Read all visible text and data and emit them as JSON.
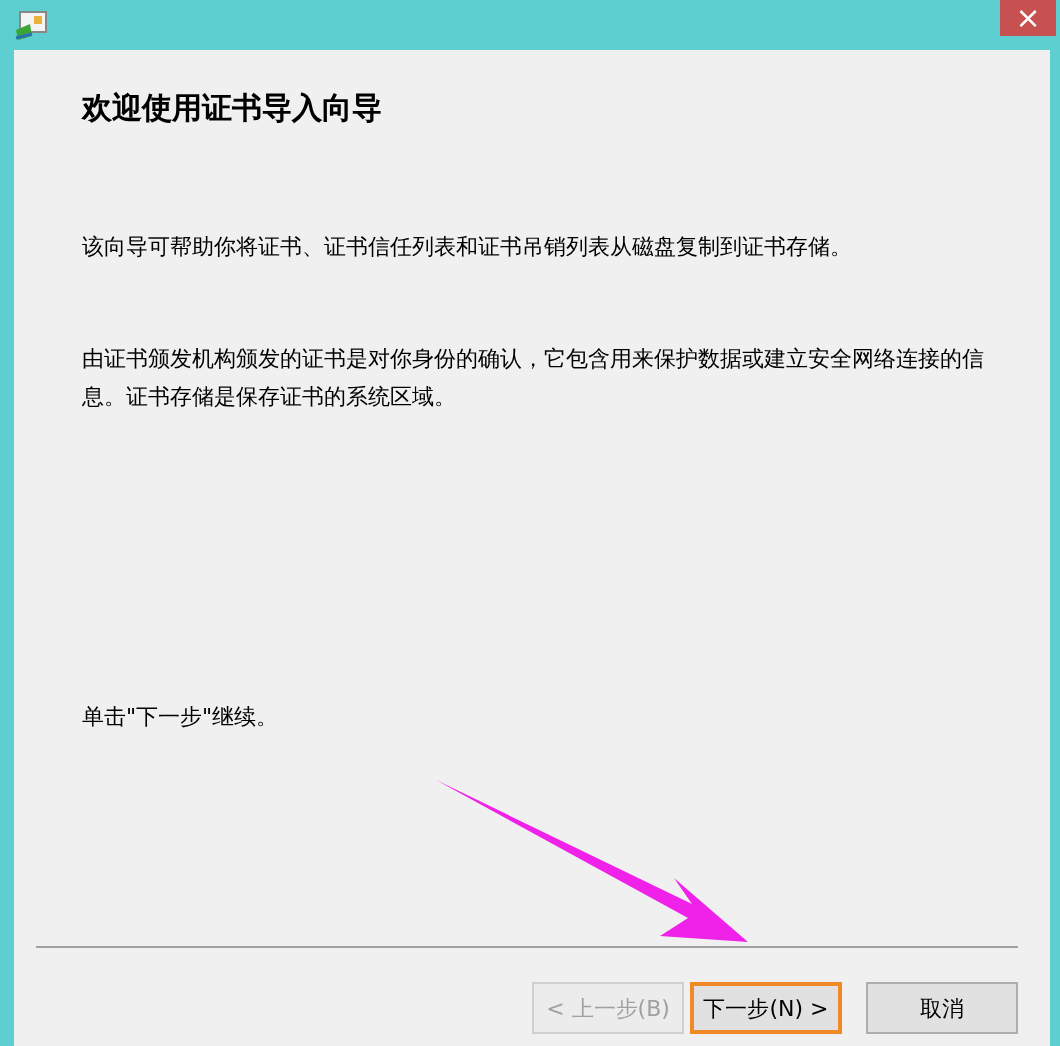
{
  "window": {
    "close": "×"
  },
  "heading": "欢迎使用证书导入向导",
  "paragraphs": [
    "该向导可帮助你将证书、证书信任列表和证书吊销列表从磁盘复制到证书存储。",
    "由证书颁发机构颁发的证书是对你身份的确认，它包含用来保护数据或建立安全网络连接的信息。证书存储是保存证书的系统区域。"
  ],
  "instruction": "单击\"下一步\"继续。",
  "buttons": [
    {
      "label": "< 上一步(B)",
      "disabled": true,
      "focused": false
    },
    {
      "label": "下一步(N) >",
      "disabled": false,
      "focused": true
    },
    {
      "label": "取消",
      "disabled": false,
      "focused": false
    }
  ]
}
